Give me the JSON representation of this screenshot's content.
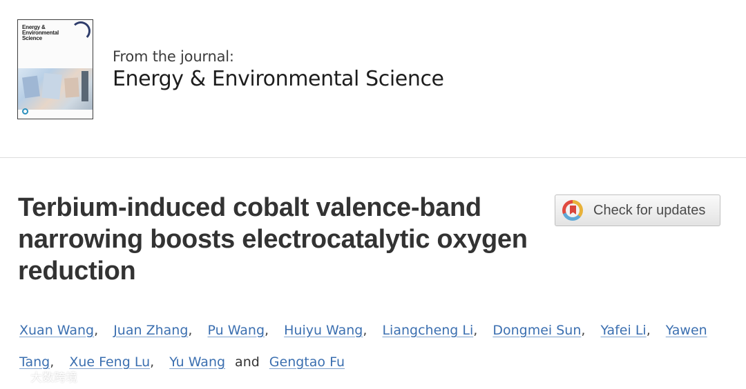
{
  "journal": {
    "cover_title": "Energy & Environmental Science",
    "from_label": "From the journal:",
    "name": "Energy & Environmental Science"
  },
  "article": {
    "title": "Terbium-induced cobalt valence-band narrowing boosts electrocatalytic oxygen reduction"
  },
  "update_button": {
    "label": "Check for updates",
    "icon": "check-for-updates-icon"
  },
  "authors": {
    "list": [
      "Xuan Wang",
      "Juan Zhang",
      "Pu Wang",
      "Huiyu Wang",
      "Liangcheng Li",
      "Dongmei Sun",
      "Yafei Li",
      "Yawen Tang",
      "Xue Feng Lu",
      "Yu Wang",
      "Gengtao Fu"
    ],
    "separator": ",",
    "conjunction": "and"
  },
  "watermark": {
    "text": "大数跨境",
    "icon": "logo-icon"
  },
  "colors": {
    "link": "#3b6fb0",
    "title": "#333333",
    "divider": "#dcdcdc"
  }
}
